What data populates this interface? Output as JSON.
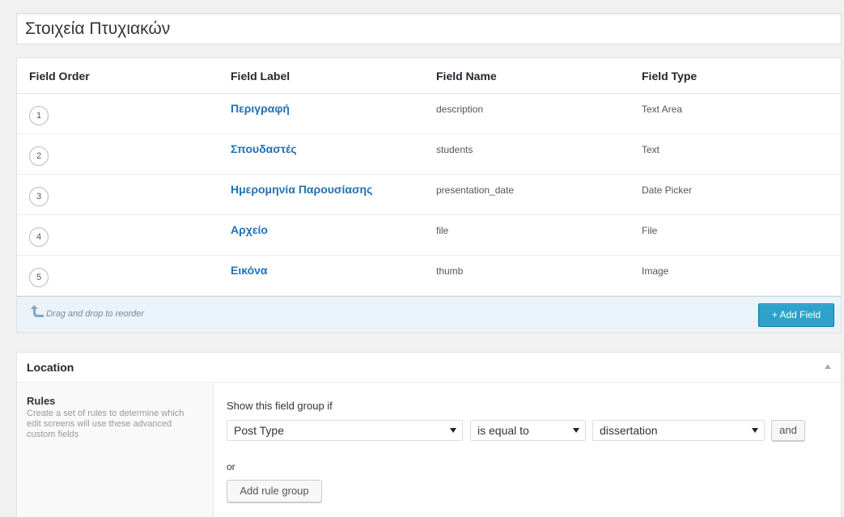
{
  "title": "Στοιχεία Πτυχιακών",
  "fields_table": {
    "headers": [
      "Field Order",
      "Field Label",
      "Field Name",
      "Field Type"
    ],
    "rows": [
      {
        "order": "1",
        "label": "Περιγραφή",
        "name": "description",
        "type": "Text Area"
      },
      {
        "order": "2",
        "label": "Σπουδαστές",
        "name": "students",
        "type": "Text"
      },
      {
        "order": "3",
        "label": "Ημερομηνία Παρουσίασης",
        "name": "presentation_date",
        "type": "Date Picker"
      },
      {
        "order": "4",
        "label": "Αρχείο",
        "name": "file",
        "type": "File"
      },
      {
        "order": "5",
        "label": "Εικόνα",
        "name": "thumb",
        "type": "Image"
      }
    ],
    "drag_hint": "Drag and drop to reorder",
    "add_field_label": "+ Add Field"
  },
  "location": {
    "title": "Location",
    "rules_title": "Rules",
    "rules_description": "Create a set of rules to determine which edit screens will use these advanced custom fields",
    "show_if_label": "Show this field group if",
    "rule": {
      "param": "Post Type",
      "operator": "is equal to",
      "value": "dissertation"
    },
    "and_label": "and",
    "or_label": "or",
    "add_rule_group_label": "Add rule group"
  },
  "colors": {
    "link": "#2271b1",
    "primary_button": "#2ea2cc",
    "footer_bg": "#eaf2fa"
  }
}
